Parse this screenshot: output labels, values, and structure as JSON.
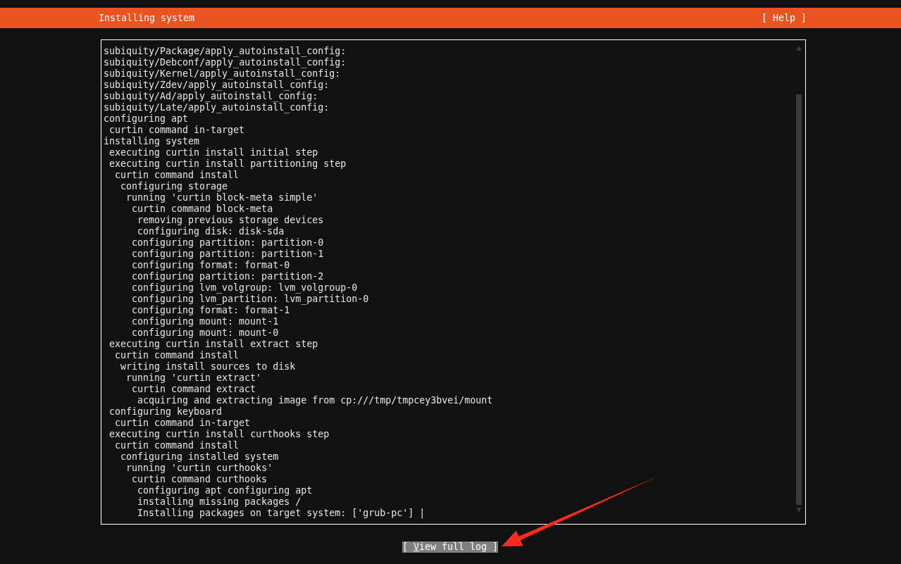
{
  "header": {
    "title": "Installing system",
    "help": "[ Help ]"
  },
  "log": [
    {
      "text": "subiquity/Package/apply_autoinstall_config:"
    },
    {
      "text": "subiquity/Debconf/apply_autoinstall_config:"
    },
    {
      "text": "subiquity/Kernel/apply_autoinstall_config:"
    },
    {
      "text": "subiquity/Zdev/apply_autoinstall_config:"
    },
    {
      "text": "subiquity/Ad/apply_autoinstall_config:"
    },
    {
      "text": "subiquity/Late/apply_autoinstall_config:"
    },
    {
      "text": "configuring apt",
      "children": [
        {
          "text": "curtin command in-target"
        }
      ]
    },
    {
      "text": "installing system",
      "children": [
        {
          "text": "executing curtin install initial step"
        },
        {
          "text": "executing curtin install partitioning step",
          "children": [
            {
              "text": "curtin command install",
              "children": [
                {
                  "text": "configuring storage",
                  "children": [
                    {
                      "text": "running 'curtin block-meta simple'",
                      "children": [
                        {
                          "text": "curtin command block-meta",
                          "children": [
                            {
                              "text": "removing previous storage devices"
                            },
                            {
                              "text": "configuring disk: disk-sda"
                            }
                          ]
                        },
                        {
                          "text": "configuring partition: partition-0"
                        },
                        {
                          "text": "configuring partition: partition-1"
                        },
                        {
                          "text": "configuring format: format-0"
                        },
                        {
                          "text": "configuring partition: partition-2"
                        },
                        {
                          "text": "configuring lvm_volgroup: lvm_volgroup-0"
                        },
                        {
                          "text": "configuring lvm_partition: lvm_partition-0"
                        },
                        {
                          "text": "configuring format: format-1"
                        },
                        {
                          "text": "configuring mount: mount-1"
                        },
                        {
                          "text": "configuring mount: mount-0"
                        }
                      ]
                    }
                  ]
                }
              ]
            }
          ]
        },
        {
          "text": "executing curtin install extract step",
          "children": [
            {
              "text": "curtin command install",
              "children": [
                {
                  "text": "writing install sources to disk",
                  "children": [
                    {
                      "text": "running 'curtin extract'",
                      "children": [
                        {
                          "text": "curtin command extract",
                          "children": [
                            {
                              "text": "acquiring and extracting image from cp:///tmp/tmpcey3bvei/mount"
                            }
                          ]
                        }
                      ]
                    }
                  ]
                }
              ]
            }
          ]
        },
        {
          "text": "configuring keyboard",
          "children": [
            {
              "text": "curtin command in-target"
            }
          ]
        },
        {
          "text": "executing curtin install curthooks step",
          "children": [
            {
              "text": "curtin command install",
              "children": [
                {
                  "text": "configuring installed system",
                  "children": [
                    {
                      "text": "running 'curtin curthooks'",
                      "children": [
                        {
                          "text": "curtin command curthooks",
                          "children": [
                            {
                              "text": "configuring apt configuring apt"
                            },
                            {
                              "text": "installing missing packages /"
                            },
                            {
                              "text": "Installing packages on target system: ['grub-pc'] |"
                            }
                          ]
                        }
                      ]
                    }
                  ]
                }
              ]
            }
          ]
        }
      ]
    }
  ],
  "button": {
    "before": "[ ",
    "hotkey": "V",
    "after": "iew full log ]"
  }
}
